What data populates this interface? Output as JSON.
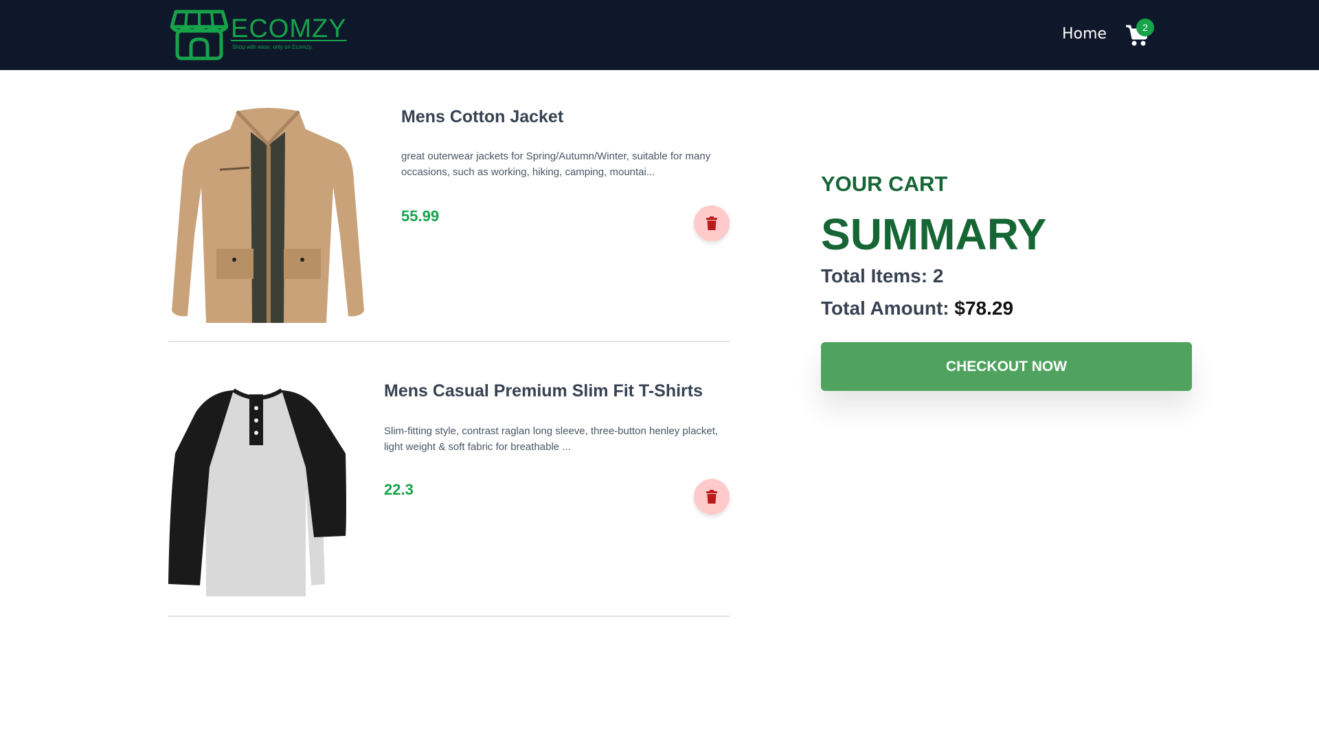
{
  "brand": {
    "name": "ECOMZY",
    "tagline": "Shop with ease, only on Ecomzy.",
    "color": "#16a34a"
  },
  "nav": {
    "home_label": "Home",
    "cart_icon": "cart-icon",
    "cart_count": "2"
  },
  "cart_items": [
    {
      "title": "Mens Cotton Jacket",
      "description": "great outerwear jackets for Spring/Autumn/Winter, suitable for many occasions, such as working, hiking, camping, mountai...",
      "price": "55.99",
      "delete_icon": "trash-icon"
    },
    {
      "title": "Mens Casual Premium Slim Fit T-Shirts",
      "description": "Slim-fitting style, contrast raglan long sleeve, three-button henley placket, light weight & soft fabric for breathable ...",
      "price": "22.3",
      "delete_icon": "trash-icon"
    }
  ],
  "summary": {
    "label": "YOUR CART",
    "title": "SUMMARY",
    "total_items_label": "Total Items: ",
    "total_items_value": "2",
    "total_amount_label": "Total Amount: ",
    "total_amount_value": "$78.29",
    "checkout_label": "CHECKOUT NOW"
  },
  "colors": {
    "navbar_bg": "#0f172a",
    "accent_green": "#16a34a",
    "summary_green": "#166534",
    "checkout_bg": "#4fa35f",
    "delete_bg": "#fecaca",
    "delete_icon": "#b91c1c"
  }
}
